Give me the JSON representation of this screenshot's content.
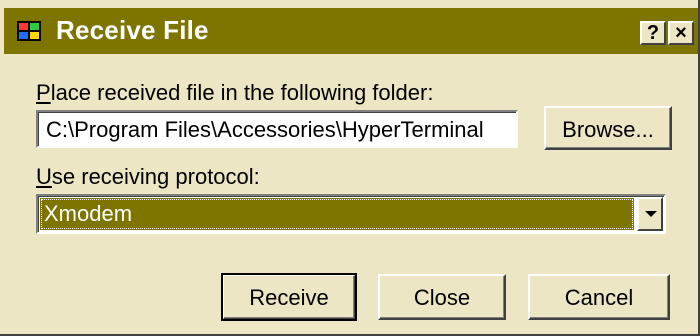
{
  "window": {
    "title": "Receive File",
    "help_label": "?",
    "close_label": "×",
    "icon": "hyperterminal-icon"
  },
  "folder": {
    "label": "Place received file in the following folder:",
    "value": "C:\\Program Files\\Accessories\\HyperTerminal",
    "browse_label": "Browse..."
  },
  "protocol": {
    "label": "Use receiving protocol:",
    "selected": "Xmodem"
  },
  "actions": {
    "receive_label": "Receive",
    "close_label": "Close",
    "cancel_label": "Cancel"
  },
  "colors": {
    "title_bar": "#7e7400",
    "dialog_bg": "#ece6c4",
    "selection": "#7e7400"
  }
}
